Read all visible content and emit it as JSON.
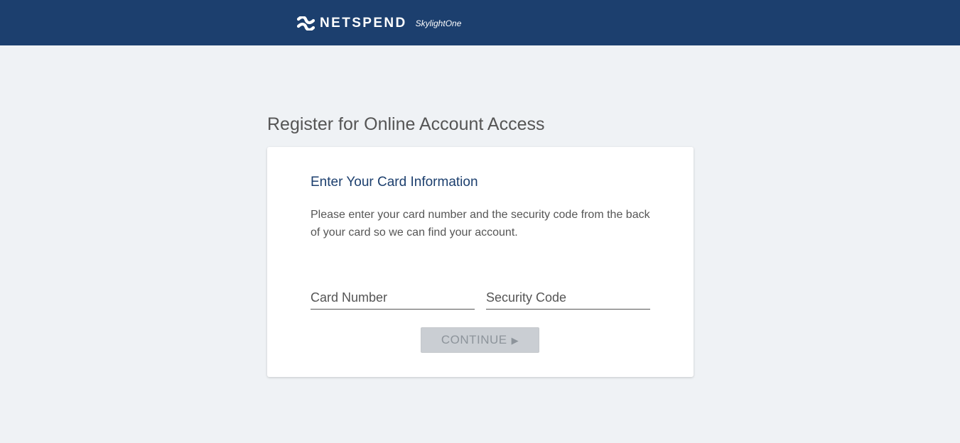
{
  "header": {
    "brand_name": "NETSPEND",
    "brand_sub": "SkylightOne",
    "logo_icon": "netspend-logo-icon",
    "background_color": "#1c3f6e"
  },
  "page": {
    "title": "Register for Online Account Access",
    "background_color": "#eff2f5"
  },
  "card": {
    "heading": "Enter Your Card Information",
    "description": "Please enter your card number and the security code from the back of your card so we can find your account.",
    "card_number": {
      "placeholder": "Card Number",
      "value": ""
    },
    "security_code": {
      "placeholder": "Security Code",
      "value": ""
    },
    "continue_button": {
      "label": "CONTINUE",
      "icon": "play-arrow-icon",
      "arrow": "▶",
      "state": "disabled"
    },
    "heading_color": "#1c3f6e"
  }
}
